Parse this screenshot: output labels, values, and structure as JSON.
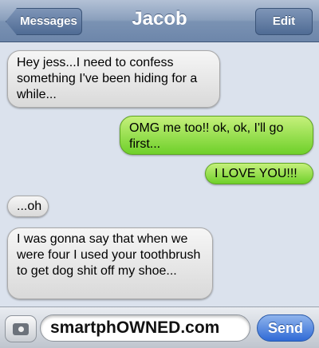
{
  "header": {
    "title": "Jacob",
    "back_label": "Messages",
    "edit_label": "Edit"
  },
  "messages": [
    {
      "type": "received",
      "text": "Hey jess...I need to confess something I've been hiding for a while..."
    },
    {
      "type": "sent",
      "text": "OMG me too!! ok, ok, I'll go first..."
    },
    {
      "type": "sent",
      "text": "I LOVE YOU!!!"
    },
    {
      "type": "received",
      "text": "...oh"
    },
    {
      "type": "received",
      "text": "I was gonna say that when we were four I used your toothbrush to get dog shit off my shoe..."
    }
  ],
  "compose": {
    "text_value": "smartphOWNED.com",
    "send_label": "Send",
    "camera_icon": "camera-icon"
  }
}
